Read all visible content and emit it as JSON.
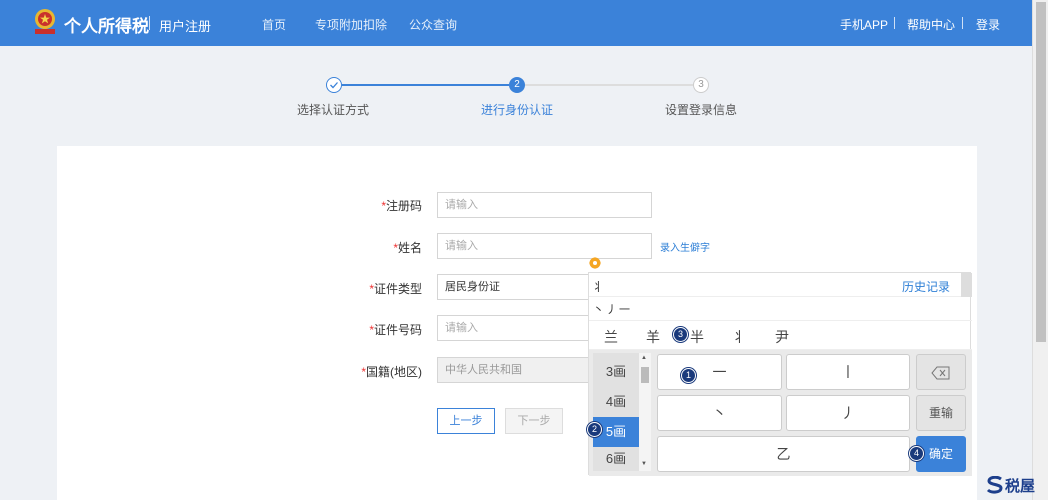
{
  "header": {
    "brand": "个人所得税",
    "subtitle": "用户注册",
    "nav": [
      "首页",
      "专项附加扣除",
      "公众查询"
    ],
    "right_nav": [
      "手机APP",
      "帮助中心",
      "登录"
    ],
    "colors": {
      "primary": "#3b82d9"
    }
  },
  "steps": [
    {
      "number": "1",
      "label": "选择认证方式",
      "state": "done"
    },
    {
      "number": "2",
      "label": "进行身份认证",
      "state": "active"
    },
    {
      "number": "3",
      "label": "设置登录信息",
      "state": "pending"
    }
  ],
  "form": {
    "required_mark": "*",
    "fields": [
      {
        "label": "注册码",
        "value": "",
        "placeholder": "请输入"
      },
      {
        "label": "姓名",
        "value": "",
        "placeholder": "请输入"
      },
      {
        "label": "证件类型",
        "value": "居民身份证"
      },
      {
        "label": "证件号码",
        "value": "",
        "placeholder": "请输入"
      },
      {
        "label": "国籍(地区)",
        "value": "中华人民共和国"
      }
    ],
    "rare_char_link": "录入生僻字",
    "prev_button": "上一步",
    "next_button": "下一步"
  },
  "keyboard": {
    "input_char": "丬",
    "history_link": "历史记录",
    "strokes": "丶丿一",
    "candidates": [
      "兰",
      "羊",
      "半",
      "丬",
      "尹"
    ],
    "stroke_counts": [
      "3画",
      "4画",
      "5画",
      "6画"
    ],
    "selected_count": "5画",
    "keys": {
      "heng": "一",
      "shu": "丨",
      "dian": "丶",
      "pie": "丿",
      "zhe": "乙",
      "rewrite": "重输",
      "confirm": "确定"
    },
    "badges": [
      "1",
      "2",
      "3",
      "4"
    ]
  },
  "watermark": "税屋"
}
